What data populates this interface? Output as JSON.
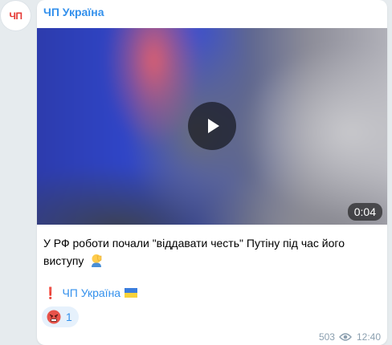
{
  "channel": {
    "avatar_text": "ЧП",
    "name": "ЧП Україна"
  },
  "video": {
    "duration": "0:04"
  },
  "message": {
    "caption": "У РФ роботи почали \"віддавати честь\" Путіну під час його виступу",
    "signature_prefix": "❗️",
    "signature_link": "ЧП Україна"
  },
  "reaction": {
    "emoji": "angry-face-icon",
    "count": "1"
  },
  "meta": {
    "views": "503",
    "time": "12:40"
  },
  "colors": {
    "accent": "#3390ec",
    "background": "#e6ebee",
    "bubble": "#ffffff"
  }
}
